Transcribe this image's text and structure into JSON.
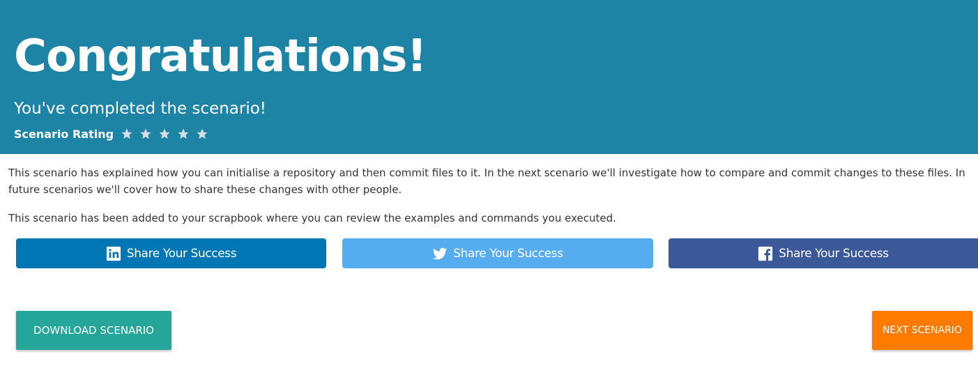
{
  "header": {
    "title": "Congratulations!",
    "subtitle": "You've completed the scenario!",
    "rating_label": "Scenario Rating",
    "stars": [
      "star-icon",
      "star-icon",
      "star-icon",
      "star-icon",
      "star-icon"
    ]
  },
  "body": {
    "paragraph_1": "This scenario has explained how you can initialise a repository and then commit files to it. In the next scenario we'll investigate how to compare and commit changes to these files. In future scenarios we'll cover how to share these changes with other people.",
    "paragraph_2": "This scenario has been added to your scrapbook where you can review the examples and commands you executed."
  },
  "share": {
    "linkedin_label": "Share Your Success",
    "twitter_label": "Share Your Success",
    "facebook_label": "Share Your Success"
  },
  "actions": {
    "download_label": "DOWNLOAD SCENARIO",
    "next_label": "NEXT SCENARIO"
  },
  "colors": {
    "header_bg": "#1e84a6",
    "linkedin": "#0077b5",
    "twitter": "#55acee",
    "facebook": "#3b5998",
    "download": "#26a69a",
    "next": "#ff7a00",
    "star": "#d3dee4"
  }
}
